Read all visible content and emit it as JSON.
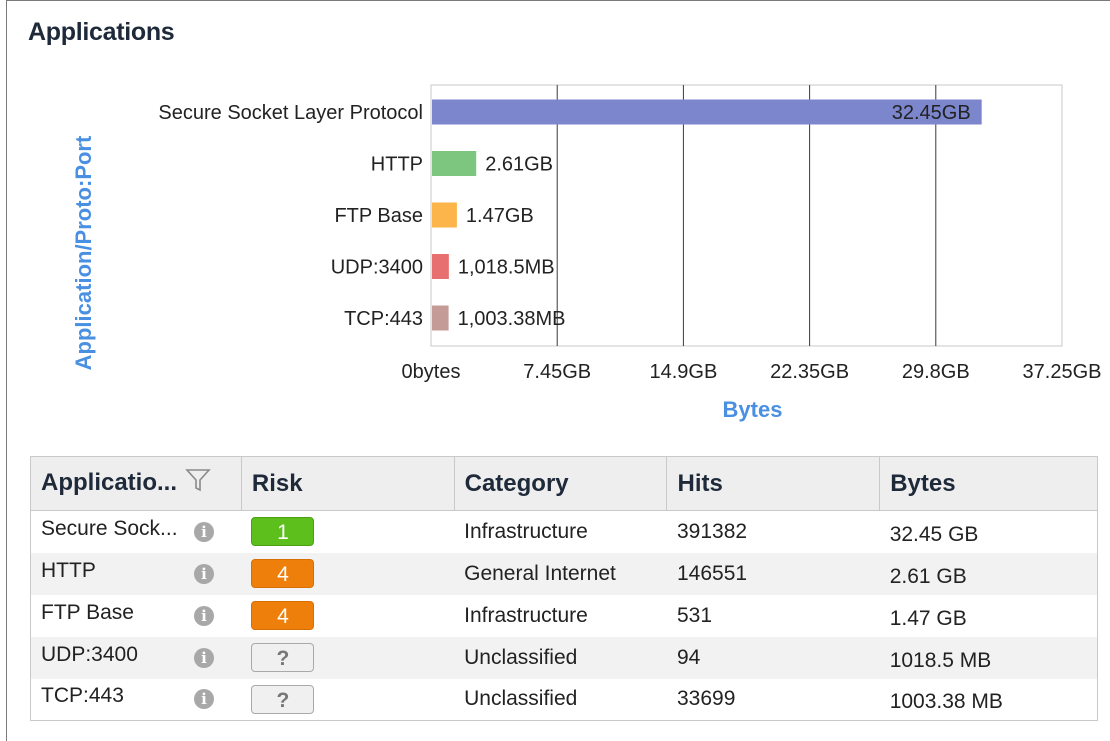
{
  "panel": {
    "title": "Applications"
  },
  "chart_data": {
    "type": "bar",
    "orientation": "horizontal",
    "ylabel": "Application/Proto:Port",
    "xlabel": "Bytes",
    "categories": [
      "Secure Socket Layer Protocol",
      "HTTP",
      "FTP Base",
      "UDP:3400",
      "TCP:443"
    ],
    "values_gb": [
      32.45,
      2.61,
      1.47,
      0.9946,
      0.9799
    ],
    "data_labels": [
      "32.45GB",
      "2.61GB",
      "1.47GB",
      "1,018.5MB",
      "1,003.38MB"
    ],
    "bar_colors": [
      "#7b86cc",
      "#7cc67f",
      "#fbb54a",
      "#e86f6f",
      "#c49b96"
    ],
    "x_ticks": [
      "0bytes",
      "7.45GB",
      "14.9GB",
      "22.35GB",
      "29.8GB",
      "37.25GB"
    ],
    "xlim": [
      0,
      37.25
    ],
    "grid": true,
    "axis_title_color": "#4a90e2"
  },
  "table": {
    "columns": [
      "Applicatio...",
      "Risk",
      "Category",
      "Hits",
      "Bytes"
    ],
    "rows": [
      {
        "app": "Secure Sock...",
        "risk": "1",
        "risk_level": "low",
        "category": "Infrastructure",
        "hits": "391382",
        "bytes": "32.45 GB"
      },
      {
        "app": "HTTP",
        "risk": "4",
        "risk_level": "high",
        "category": "General Internet",
        "hits": "146551",
        "bytes": "2.61 GB"
      },
      {
        "app": "FTP Base",
        "risk": "4",
        "risk_level": "high",
        "category": "Infrastructure",
        "hits": "531",
        "bytes": "1.47 GB"
      },
      {
        "app": "UDP:3400",
        "risk": "?",
        "risk_level": "unknown",
        "category": "Unclassified",
        "hits": "94",
        "bytes": "1018.5 MB"
      },
      {
        "app": "TCP:443",
        "risk": "?",
        "risk_level": "unknown",
        "category": "Unclassified",
        "hits": "33699",
        "bytes": "1003.38 MB"
      }
    ],
    "info_icon": "i"
  }
}
